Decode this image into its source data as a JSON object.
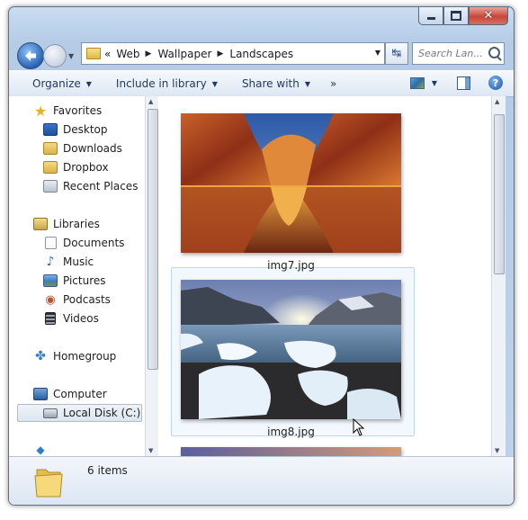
{
  "window": {
    "caption": {
      "minimize": "—",
      "maximize": "▢",
      "close": "✕"
    }
  },
  "nav": {
    "breadcrumbs": [
      "Web",
      "Wallpaper",
      "Landscapes"
    ],
    "overflow": "«",
    "search_placeholder": "Search Lan..."
  },
  "toolbar": {
    "organize": "Organize",
    "include": "Include in library",
    "share": "Share with",
    "more": "»"
  },
  "navpane": {
    "favorites": "Favorites",
    "fav_items": [
      "Desktop",
      "Downloads",
      "Dropbox",
      "Recent Places"
    ],
    "libraries": "Libraries",
    "lib_items": [
      "Documents",
      "Music",
      "Pictures",
      "Podcasts",
      "Videos"
    ],
    "homegroup": "Homegroup",
    "computer": "Computer",
    "computer_items": [
      "Local Disk (C:)"
    ]
  },
  "files": [
    {
      "name": "img7.jpg"
    },
    {
      "name": "img8.jpg"
    }
  ],
  "details": {
    "status": "6 items"
  },
  "colors": {
    "accent": "#2b63b4",
    "selection": "#dde5ef",
    "hover": "#bcd6ee"
  }
}
